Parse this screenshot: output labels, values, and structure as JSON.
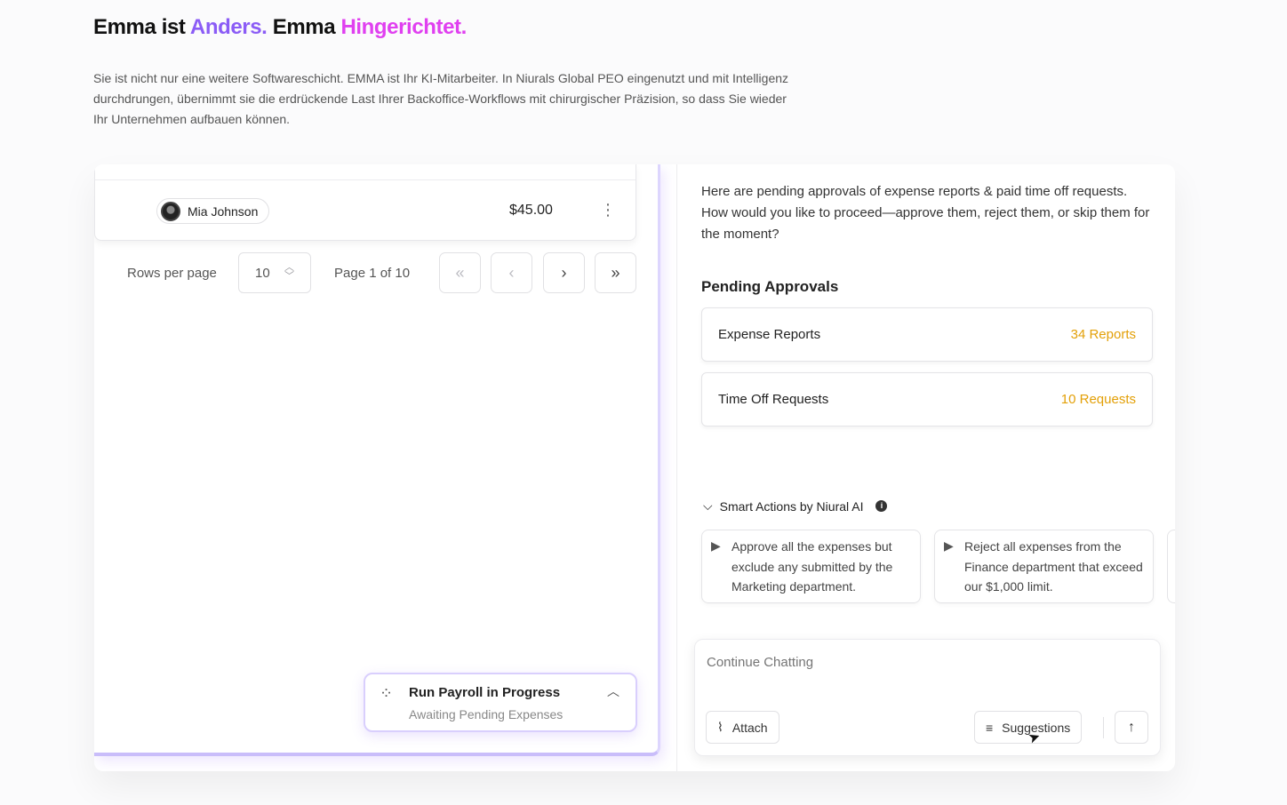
{
  "headline": {
    "part1": "Emma ist ",
    "accent1": "Anders.",
    "part2": " Emma ",
    "accent2": "Hingerichtet."
  },
  "intro": "Sie ist nicht nur eine weitere Softwareschicht. EMMA ist Ihr KI-Mitarbeiter. In Niurals Global PEO eingenutzt und mit Intelligenz durchdrungen, übernimmt sie die erdrückende Last Ihrer Backoffice-Workflows mit chirurgischer Präzision, so dass Sie wieder Ihr Unternehmen aufbauen können.",
  "colors": {
    "accent_purple": "#8b5cf6",
    "accent_pink": "#e040f0",
    "count_amber": "#e3a008"
  },
  "table_row": {
    "name": "Mia Johnson",
    "amount": "$45.00"
  },
  "pagination": {
    "rows_label": "Rows per page",
    "rows_value": "10",
    "page_label": "Page 1 of  10"
  },
  "payroll": {
    "title": "Run Payroll in Progress",
    "subtitle": "Awaiting Pending Expenses"
  },
  "chat": {
    "message": "Here are pending approvals of expense reports & paid time off requests. How would you like to proceed—approve them, reject them, or skip them for the moment?",
    "section_title": "Pending Approvals",
    "approvals": [
      {
        "label": "Expense Reports",
        "count": "34 Reports"
      },
      {
        "label": "Time Off Requests",
        "count": "10 Requests"
      }
    ],
    "smart_actions_label": "Smart Actions by Niural AI",
    "suggestions": [
      "Approve all the expenses but exclude any submitted by the Marketing department.",
      "Reject all expenses from the Finance department that exceed our $1,000 limit."
    ],
    "input_placeholder": "Continue Chatting",
    "attach_label": "Attach",
    "suggestions_label": "Suggestions"
  }
}
